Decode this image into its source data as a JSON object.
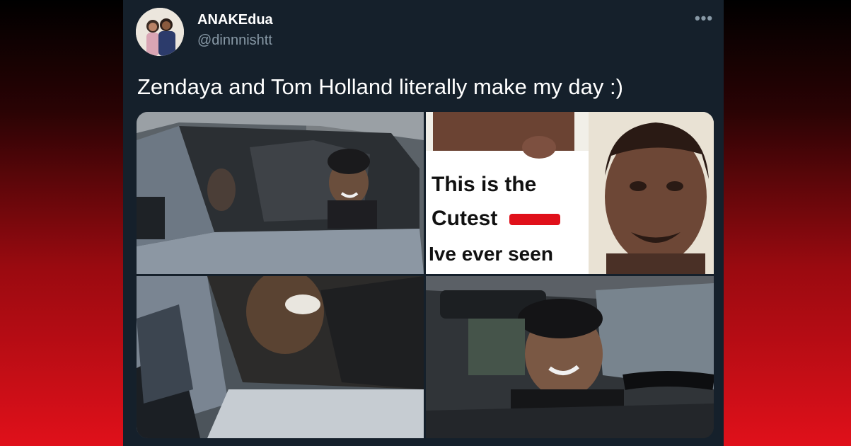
{
  "tweet": {
    "display_name": "ANAKEdua",
    "handle": "@dinnnishtt",
    "text": "Zendaya and Tom Holland literally make my day :)",
    "more_label": "•••",
    "media": {
      "sign_line_1": "This is the",
      "sign_line_2": "Cutest",
      "sign_line_3": "Ive ever seen"
    }
  },
  "colors": {
    "card_background": "#15202b",
    "primary_text": "#ffffff",
    "secondary_text": "#8899a6",
    "censor_red": "#e0101a"
  }
}
